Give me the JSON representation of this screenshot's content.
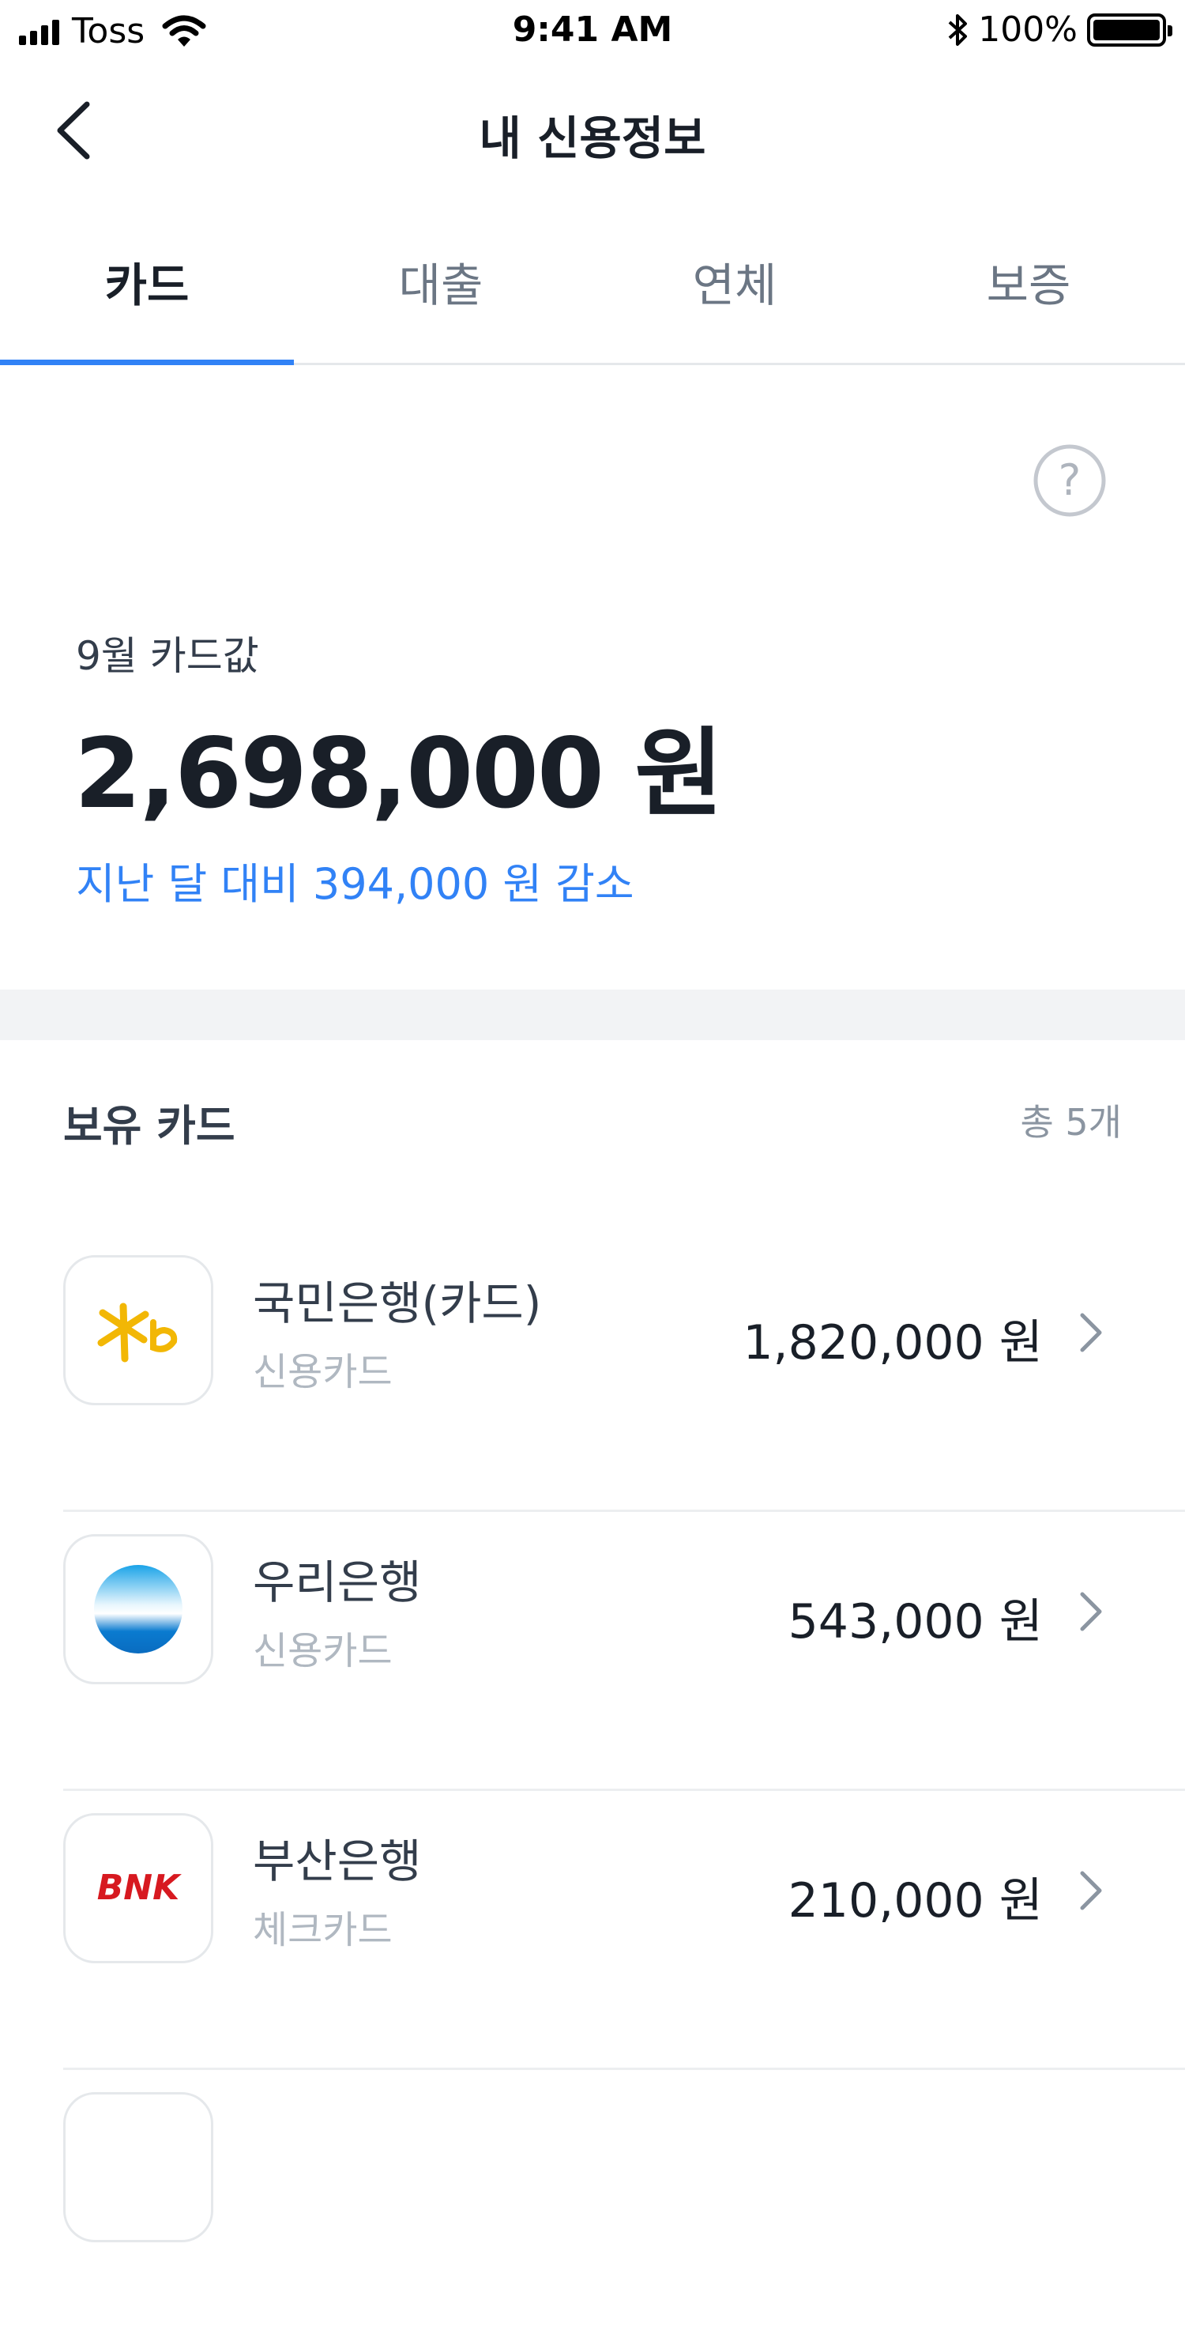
{
  "status_bar": {
    "carrier": "Toss",
    "time": "9:41 AM",
    "battery": "100%",
    "icons": [
      "signal-icon",
      "wifi-icon",
      "bluetooth-icon",
      "battery-icon"
    ]
  },
  "header": {
    "title": "내 신용정보",
    "back_icon": "back-arrow-icon"
  },
  "tabs": [
    {
      "label": "카드",
      "active": true
    },
    {
      "label": "대출",
      "active": false
    },
    {
      "label": "연체",
      "active": false
    },
    {
      "label": "보증",
      "active": false
    }
  ],
  "summary": {
    "help_icon": "question-circle-icon",
    "month_label": "9월 카드값",
    "total_amount": "2,698,000 원",
    "change_text": "지난 달 대비 394,000 원 감소"
  },
  "cards_section": {
    "title": "보유 카드",
    "count": "총 5개",
    "items": [
      {
        "name": "국민은행(카드)",
        "type": "신용카드",
        "amount": "1,820,000 원",
        "logo_text": "Kb",
        "logo_color": "#f2b705"
      },
      {
        "name": "우리은행",
        "type": "신용카드",
        "amount": "543,000 원",
        "logo_text": "",
        "logo_color": "#0a7bd0"
      },
      {
        "name": "부산은행",
        "type": "체크카드",
        "amount": "210,000 원",
        "logo_text": "BNK",
        "logo_color": "#d71920"
      }
    ]
  },
  "colors": {
    "accent": "#3182f6",
    "text_primary": "#191f28",
    "text_secondary": "#b0b8c1",
    "divider": "#f2f3f5"
  }
}
